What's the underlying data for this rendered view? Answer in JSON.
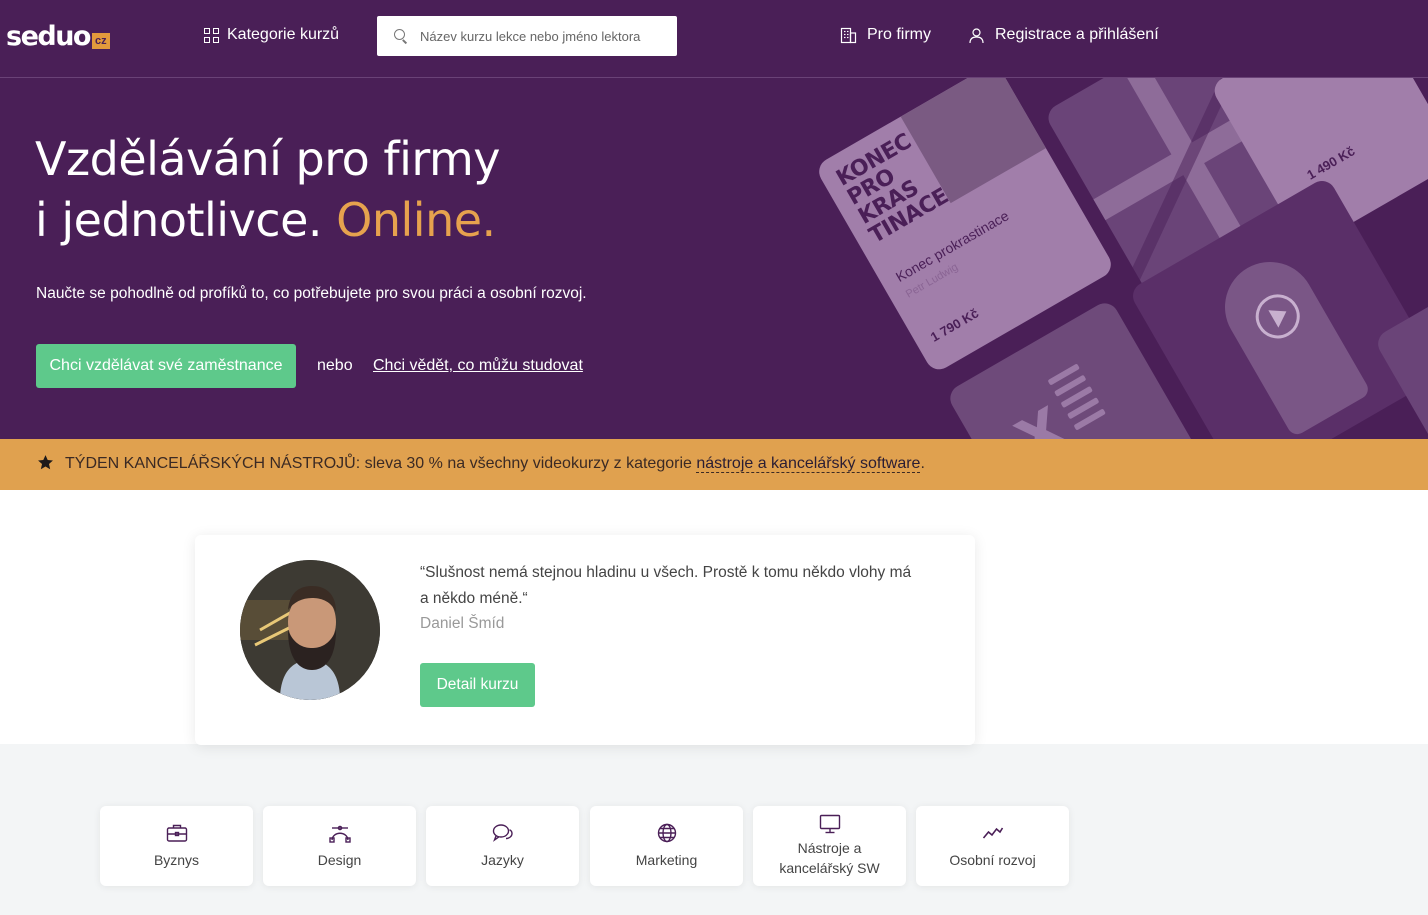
{
  "header": {
    "logo_text": "seduo",
    "logo_badge": "cz",
    "categories_label": "Kategorie kurzů",
    "search_placeholder": "Název kurzu lekce nebo jméno lektora",
    "companies_label": "Pro firmy",
    "login_label": "Registrace a přihlášení"
  },
  "hero": {
    "title_line1": "Vzdělávání pro firmy",
    "title_line2_prefix": "i jednotlivce.",
    "title_line2_accent": "Online.",
    "subtitle": "Naučte se pohodlně od profíků to, co potřebujete pro svou práci a osobní rozvoj.",
    "cta_label": "Chci vzdělávat své zaměstnance",
    "or_label": "nebo",
    "link_label": "Chci vědět, co můžu studovat",
    "tiles": {
      "card_cover": [
        "KONEC",
        "PRO",
        "KRAS",
        "TINACE"
      ],
      "card_title": "Konec prokrastinace",
      "card_author": "Petr Ludwig",
      "card_price": "1 790 Kč",
      "card2_price": "1 490 Kč"
    }
  },
  "promo": {
    "prefix": "TÝDEN KANCELÁŘSKÝCH NÁSTROJŮ: sleva 30 % na všechny videokurzy z kategorie ",
    "link": "nástroje a kancelářský software",
    "suffix": "."
  },
  "testimonial": {
    "quote": "“Slušnost nemá stejnou hladinu u všech. Prostě k tomu někdo vlohy má a někdo méně.“",
    "author": "Daniel Šmíd",
    "button_label": "Detail kurzu"
  },
  "categories": [
    {
      "label": "Byznys",
      "icon": "briefcase-icon"
    },
    {
      "label": "Design",
      "icon": "bezier-curve-icon"
    },
    {
      "label": "Jazyky",
      "icon": "chat-bubbles-icon"
    },
    {
      "label": "Marketing",
      "icon": "globe-icon"
    },
    {
      "label": "Nástroje a kancelářský SW",
      "icon": "monitor-icon"
    },
    {
      "label": "Osobní rozvoj",
      "icon": "trend-chart-icon"
    }
  ],
  "colors": {
    "brand_purple": "#4a1f57",
    "accent_orange": "#e6a24e",
    "promo_bar": "#e0a14f",
    "cta_green": "#5ec98b"
  }
}
